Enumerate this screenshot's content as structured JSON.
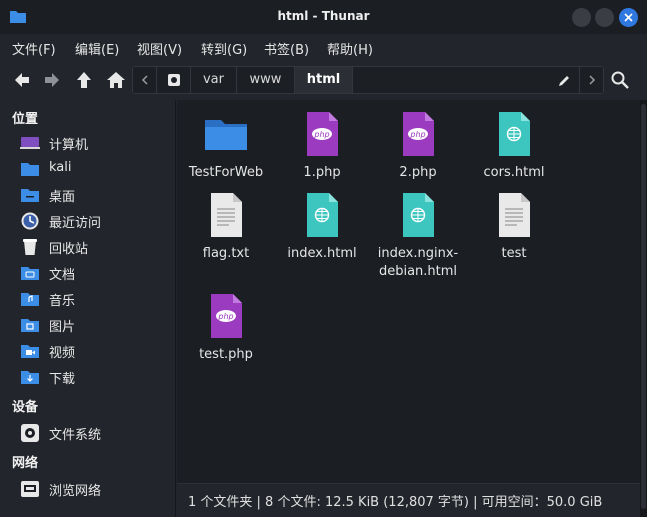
{
  "window": {
    "title": "html - Thunar"
  },
  "menu": [
    "文件(F)",
    "编辑(E)",
    "视图(V)",
    "转到(G)",
    "书签(B)",
    "帮助(H)"
  ],
  "pathbar": {
    "segments": [
      "var",
      "www",
      "html"
    ],
    "active": "html"
  },
  "sidebar": {
    "sections": [
      {
        "heading": "位置",
        "items": [
          {
            "label": "计算机",
            "icon": "computer-icon"
          },
          {
            "label": "kali",
            "icon": "home-folder-icon"
          },
          {
            "label": "桌面",
            "icon": "desktop-folder-icon"
          },
          {
            "label": "最近访问",
            "icon": "recent-icon"
          },
          {
            "label": "回收站",
            "icon": "trash-icon"
          },
          {
            "label": "文档",
            "icon": "documents-folder-icon"
          },
          {
            "label": "音乐",
            "icon": "music-folder-icon"
          },
          {
            "label": "图片",
            "icon": "pictures-folder-icon"
          },
          {
            "label": "视频",
            "icon": "videos-folder-icon"
          },
          {
            "label": "下载",
            "icon": "downloads-folder-icon"
          }
        ]
      },
      {
        "heading": "设备",
        "items": [
          {
            "label": "文件系统",
            "icon": "drive-icon"
          }
        ]
      },
      {
        "heading": "网络",
        "items": [
          {
            "label": "浏览网络",
            "icon": "network-icon"
          }
        ]
      }
    ]
  },
  "files": [
    {
      "name": "TestForWeb",
      "type": "folder"
    },
    {
      "name": "1.php",
      "type": "php"
    },
    {
      "name": "2.php",
      "type": "php"
    },
    {
      "name": "cors.html",
      "type": "html"
    },
    {
      "name": "flag.txt",
      "type": "text"
    },
    {
      "name": "index.html",
      "type": "html"
    },
    {
      "name": "index.nginx-\ndebian.html",
      "type": "html"
    },
    {
      "name": "test",
      "type": "text"
    },
    {
      "name": "test.php",
      "type": "php"
    }
  ],
  "status": {
    "text": "1 个文件夹 | 8 个文件: 12.5 KiB (12,807 字节) | 可用空间：50.0 GiB"
  },
  "colors": {
    "accent": "#2f78e0",
    "php": "#9b3cc0",
    "html": "#3cc6bf",
    "folder": "#3b8de6"
  }
}
